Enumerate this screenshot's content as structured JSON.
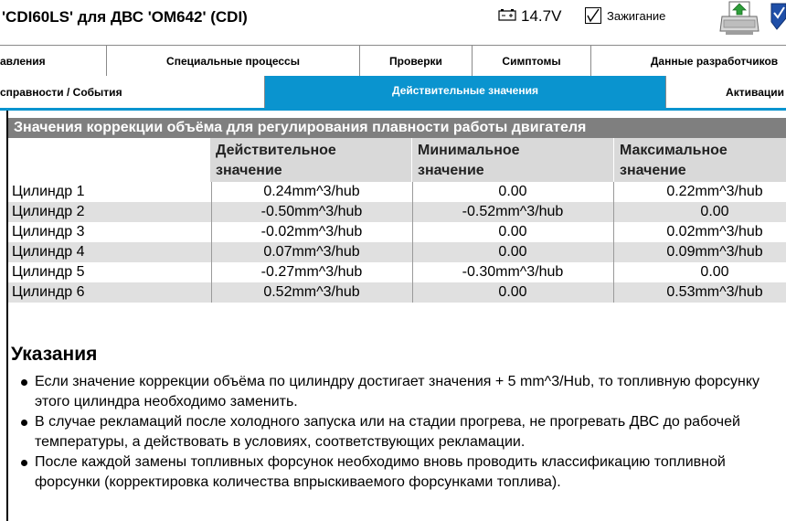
{
  "header": {
    "title": "'CDI60LS' для ДВС 'OM642' (CDI)",
    "voltage": "14.7V",
    "ignition_label": "Зажигание",
    "ignition_checked": true
  },
  "tabs_row1": [
    {
      "label": "авления"
    },
    {
      "label": "Специальные процессы"
    },
    {
      "label": "Проверки"
    },
    {
      "label": "Симптомы"
    },
    {
      "label": "Данные разработчиков"
    }
  ],
  "tabs_row2": [
    {
      "label": "справности / События"
    },
    {
      "label": "Действительные значения",
      "active": true
    },
    {
      "label": "Активации"
    }
  ],
  "section": {
    "title": "Значения коррекции объёма для регулирования плавности работы двигателя"
  },
  "table": {
    "columns": [
      {
        "line1": "Действительное",
        "line2": "значение"
      },
      {
        "line1": "Минимальное",
        "line2": "значение"
      },
      {
        "line1": "Максимальное",
        "line2": "значение"
      }
    ],
    "rows": [
      {
        "name": "Цилиндр 1",
        "actual": "0.24mm^3/hub",
        "min": "0.00",
        "max": "0.22mm^3/hub"
      },
      {
        "name": "Цилиндр 2",
        "actual": "-0.50mm^3/hub",
        "min": "-0.52mm^3/hub",
        "max": "0.00"
      },
      {
        "name": "Цилиндр 3",
        "actual": "-0.02mm^3/hub",
        "min": "0.00",
        "max": "0.02mm^3/hub"
      },
      {
        "name": "Цилиндр 4",
        "actual": "0.07mm^3/hub",
        "min": "0.00",
        "max": "0.09mm^3/hub"
      },
      {
        "name": "Цилиндр 5",
        "actual": "-0.27mm^3/hub",
        "min": "-0.30mm^3/hub",
        "max": "0.00"
      },
      {
        "name": "Цилиндр 6",
        "actual": "0.52mm^3/hub",
        "min": "0.00",
        "max": "0.53mm^3/hub"
      }
    ]
  },
  "notes": {
    "title": "Указания",
    "items": [
      "Если значение коррекции объёма по цилиндру достигает значения + 5 mm^3/Hub, то топливную форсунку этого цилиндра необходимо заменить.",
      "В случае рекламаций после холодного запуска или на стадии прогрева, не прогревать ДВС до рабочей температуры, а действовать в условиях, соответствующих рекламации.",
      "После каждой замены топливных форсунок необходимо вновь проводить классификацию топливной форсунки (корректировка количества впрыскиваемого форсунками топлива)."
    ]
  },
  "colors": {
    "active_tab": "#0a94cf",
    "section_header": "#7f7f7f",
    "table_header": "#d9d9d9",
    "row_alt": "#e0e0e0"
  },
  "icons": {
    "battery": "battery-icon",
    "checkbox": "checkmark-icon",
    "printer": "printer-icon",
    "shield": "shield-icon"
  }
}
